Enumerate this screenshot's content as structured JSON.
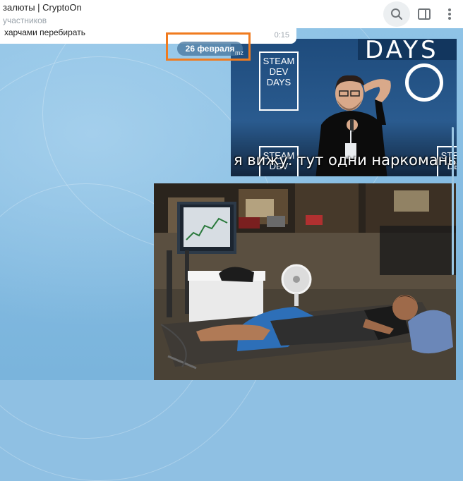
{
  "header": {
    "title": "залюты | CryptoOn",
    "subtitle": "участников",
    "icons": [
      "search-icon",
      "sidebar-toggle-icon",
      "more-vertical-icon"
    ]
  },
  "previous_message": {
    "text": "харчами перебирать",
    "time": "0:15"
  },
  "date_separator": {
    "label": "26 февраля",
    "tag": "mz",
    "highlight_color": "#f07b1f"
  },
  "photo1": {
    "banner_text": "DAYS",
    "logo_lines": [
      "STEAM",
      "DEV",
      "DAYS"
    ],
    "caption": "я вижу: тут одни наркоманы"
  },
  "colors": {
    "chat_background": "#8fc0e3",
    "header_background": "#ffffff",
    "date_pill": "#4a78a0"
  }
}
